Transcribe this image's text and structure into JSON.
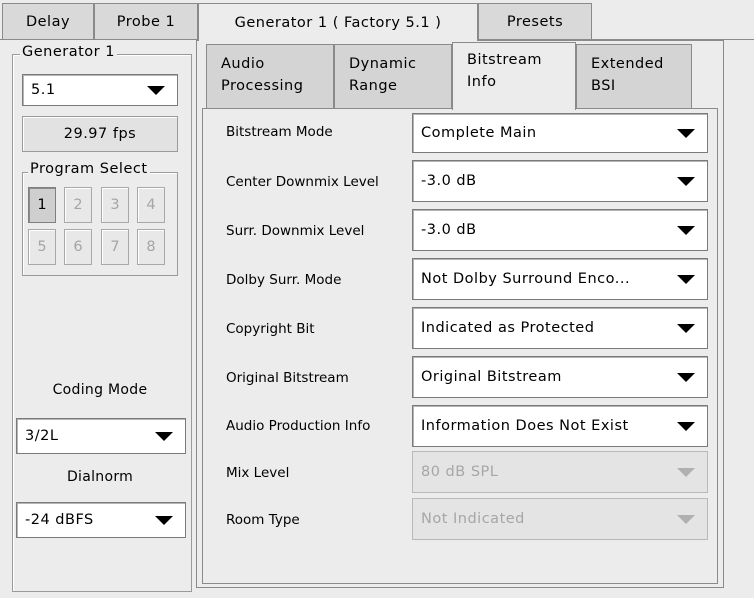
{
  "top_tabs": [
    {
      "label": "Delay"
    },
    {
      "label": "Probe 1"
    },
    {
      "label": "Generator 1 ( Factory 5.1 )"
    },
    {
      "label": "Presets"
    }
  ],
  "generator": {
    "group_label": "Generator 1",
    "preset_value": "5.1",
    "fps": "29.97 fps",
    "program_select_label": "Program Select",
    "program_buttons": [
      "1",
      "2",
      "3",
      "4",
      "5",
      "6",
      "7",
      "8"
    ],
    "selected_program": "1",
    "coding_mode_label": "Coding Mode",
    "coding_mode_value": "3/2L",
    "dialnorm_label": "Dialnorm",
    "dialnorm_value": "-24 dBFS"
  },
  "sub_tabs": [
    {
      "line1": "Audio",
      "line2": "Processing"
    },
    {
      "line1": "Dynamic",
      "line2": "Range"
    },
    {
      "line1": "Bitstream",
      "line2": "Info"
    },
    {
      "line1": "Extended",
      "line2": "BSI"
    }
  ],
  "bitstream_fields": [
    {
      "label": "Bitstream Mode",
      "value": "Complete Main",
      "enabled": true
    },
    {
      "label": "Center Downmix Level",
      "value": "-3.0 dB",
      "enabled": true
    },
    {
      "label": "Surr. Downmix Level",
      "value": "-3.0 dB",
      "enabled": true
    },
    {
      "label": "Dolby Surr. Mode",
      "value": "Not Dolby Surround Enco...",
      "enabled": true
    },
    {
      "label": "Copyright Bit",
      "value": "Indicated as Protected",
      "enabled": true
    },
    {
      "label": "Original Bitstream",
      "value": "Original Bitstream",
      "enabled": true
    },
    {
      "label": "Audio Production Info",
      "value": "Information Does Not Exist",
      "enabled": true
    },
    {
      "label": "Mix Level",
      "value": "80 dB SPL",
      "enabled": false
    },
    {
      "label": "Room Type",
      "value": "Not Indicated",
      "enabled": false
    }
  ]
}
